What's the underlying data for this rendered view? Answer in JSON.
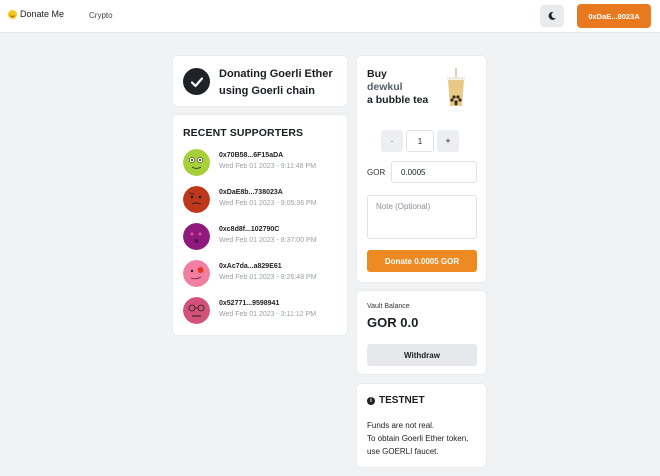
{
  "header": {
    "brand_label": "Donate Me",
    "nav_crypto": "Crypto",
    "wallet_address": "0xDaE...8023A",
    "accent_color": "#e8791f"
  },
  "title_card": {
    "title": "Donating Goerli Ether using Goerli chain"
  },
  "supporters": {
    "heading": "RECENT SUPPORTERS",
    "items": [
      {
        "address": "0x70B58...6F15aDA",
        "time": "Wed Feb 01 2023 - 9:11:48 PM",
        "avatar_color": "#a6d03a"
      },
      {
        "address": "0xDaE8b...738023A",
        "time": "Wed Feb 01 2023 - 9:05:36 PM",
        "avatar_color": "#c0381c"
      },
      {
        "address": "0xc8d8f...102790C",
        "time": "Wed Feb 01 2023 - 8:37:00 PM",
        "avatar_color": "#8e1a7e"
      },
      {
        "address": "0xAc7da...a829E61",
        "time": "Wed Feb 01 2023 - 8:26:48 PM",
        "avatar_color": "#f27fa1"
      },
      {
        "address": "0x52771...9598941",
        "time": "Wed Feb 01 2023 - 3:11:12 PM",
        "avatar_color": "#d2527c"
      }
    ]
  },
  "donate": {
    "buy_line1": "Buy",
    "buy_line2": "dewkul",
    "buy_line3": "a bubble tea",
    "minus_label": "-",
    "quantity": "1",
    "plus_label": "+",
    "currency_label": "GOR",
    "amount_value": "0.0005",
    "note_placeholder": "Note (Optional)",
    "donate_button": "Donate 0.0005 GOR"
  },
  "vault": {
    "label": "Vault Balance",
    "value": "GOR 0.0",
    "withdraw_button": "Withdraw"
  },
  "testnet": {
    "title": "TESTNET",
    "line1": "Funds are not real.",
    "line2": "To obtain Goerli Ether token, use GOERLI faucet."
  }
}
